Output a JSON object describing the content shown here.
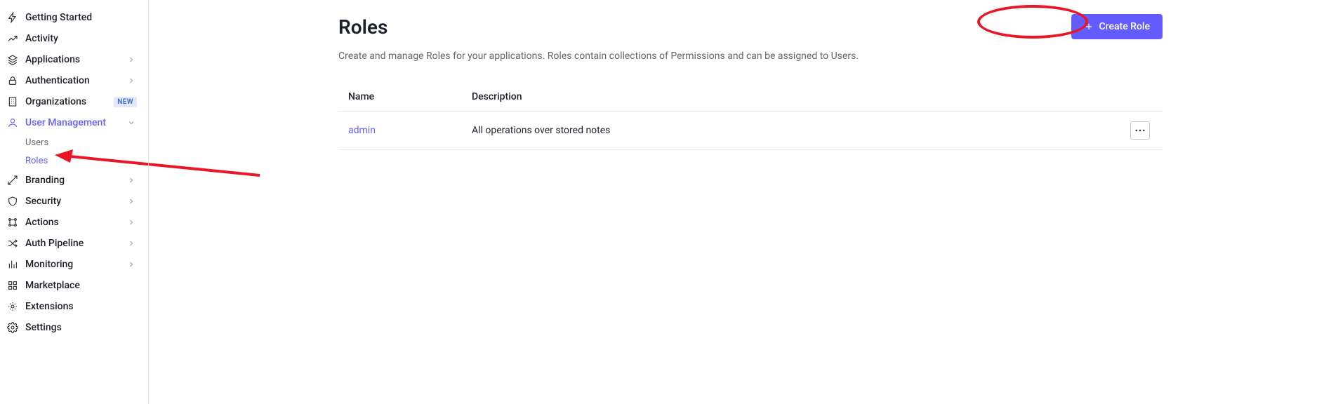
{
  "sidebar": {
    "items": [
      {
        "label": "Getting Started"
      },
      {
        "label": "Activity"
      },
      {
        "label": "Applications"
      },
      {
        "label": "Authentication"
      },
      {
        "label": "Organizations",
        "badge": "NEW"
      },
      {
        "label": "User Management"
      },
      {
        "label": "Branding"
      },
      {
        "label": "Security"
      },
      {
        "label": "Actions"
      },
      {
        "label": "Auth Pipeline"
      },
      {
        "label": "Monitoring"
      },
      {
        "label": "Marketplace"
      },
      {
        "label": "Extensions"
      },
      {
        "label": "Settings"
      }
    ],
    "sub_items": [
      {
        "label": "Users"
      },
      {
        "label": "Roles"
      }
    ]
  },
  "page": {
    "title": "Roles",
    "subtitle": "Create and manage Roles for your applications. Roles contain collections of Permissions and can be assigned to Users.",
    "create_button": "Create Role"
  },
  "table": {
    "columns": {
      "name": "Name",
      "description": "Description"
    },
    "rows": [
      {
        "name": "admin",
        "description": "All operations over stored notes"
      }
    ]
  },
  "colors": {
    "accent": "#635DFF",
    "annotation": "#e91625"
  }
}
